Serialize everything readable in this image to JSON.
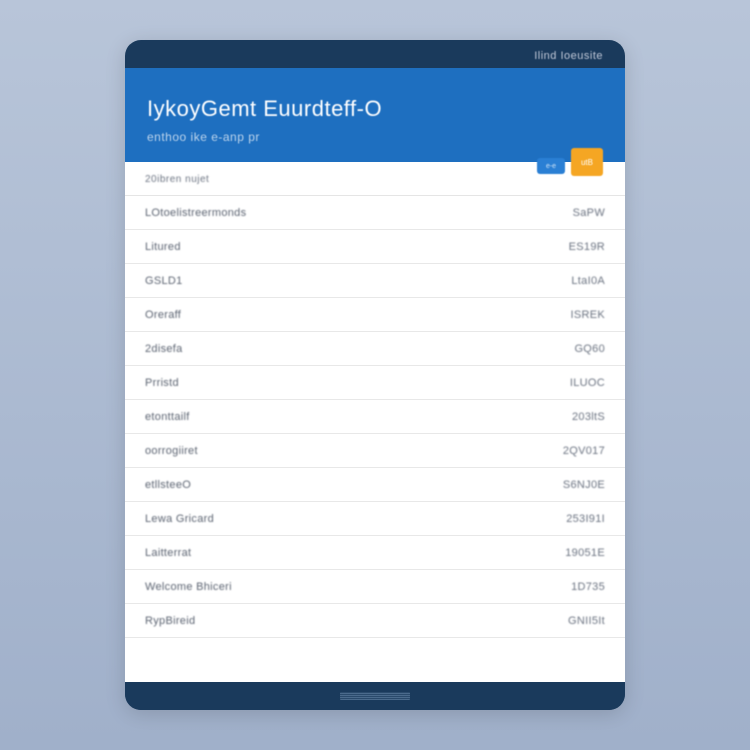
{
  "topMeta": "Ilind Ioeusite",
  "header": {
    "title": "IykoyGemt Euurdteff-O",
    "subtitle": "enthoo ike e-anp pr",
    "badgeText": "utB",
    "chipText": "e-e"
  },
  "listHeader": {
    "left": "20ibren nujet",
    "right": ""
  },
  "rows": [
    {
      "label": "LOtoelistreermonds",
      "value": "SaPW"
    },
    {
      "label": "Litured",
      "value": "ES19R"
    },
    {
      "label": "GSLD1",
      "value": "LtaI0A"
    },
    {
      "label": "Oreraff",
      "value": "ISREK"
    },
    {
      "label": "2disefa",
      "value": "GQ60"
    },
    {
      "label": "Prristd",
      "value": "ILUOC"
    },
    {
      "label": "etonttailf",
      "value": "203ltS"
    },
    {
      "label": "oorrogiiret",
      "value": "2QV017"
    },
    {
      "label": "etllsteeO",
      "value": "S6NJ0E"
    },
    {
      "label": "Lewa Gricard",
      "value": "253I91I"
    },
    {
      "label": "Laitterrat",
      "value": "19051E"
    },
    {
      "label": "Welcome Bhiceri",
      "value": "1D735"
    },
    {
      "label": "RypBireid",
      "value": "GNII5It"
    }
  ],
  "footer": {}
}
